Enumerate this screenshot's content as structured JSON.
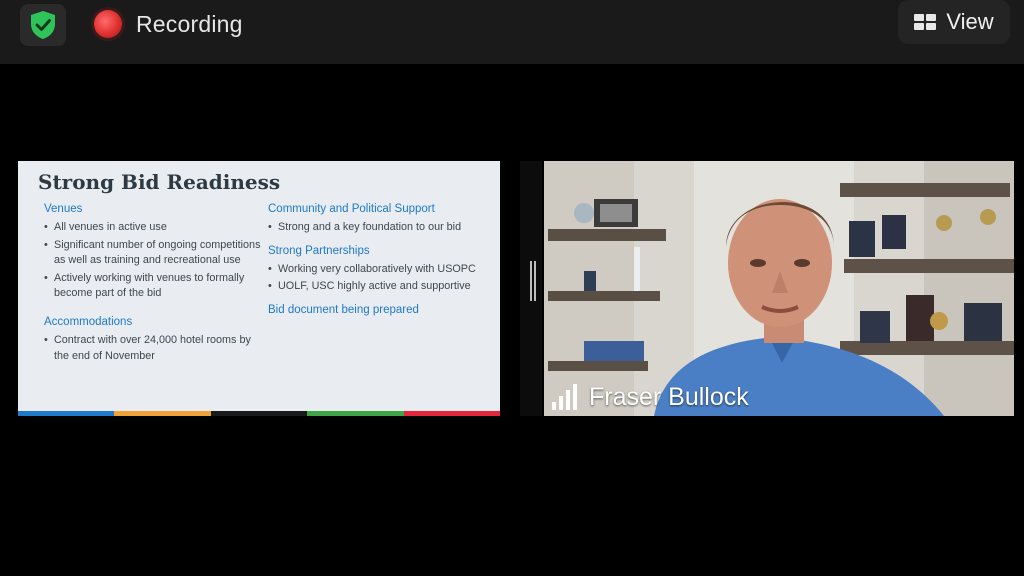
{
  "topbar": {
    "recording_label": "Recording",
    "view_label": "View",
    "icons": {
      "security": "shield-check-icon",
      "recording": "recording-dot-icon",
      "view": "grid-view-icon"
    }
  },
  "slide": {
    "title": "Strong Bid Readiness",
    "left_column": {
      "sections": [
        {
          "heading": "Venues",
          "bullets": [
            "All venues in active use",
            "Significant number of ongoing competitions as well as training and recreational use",
            "Actively working with venues to formally become part of the bid"
          ]
        },
        {
          "heading": "Accommodations",
          "bullets": [
            "Contract with over 24,000 hotel rooms by the end of November"
          ]
        }
      ]
    },
    "right_column": {
      "sections": [
        {
          "heading": "Community and Political Support",
          "bullets": [
            "Strong and a key foundation to our bid"
          ]
        },
        {
          "heading": "Strong Partnerships",
          "bullets": [
            "Working very collaboratively with USOPC",
            "UOLF, USC highly active and supportive"
          ]
        }
      ],
      "footer_heading": "Bid document being prepared"
    },
    "colors": {
      "heading": "#1e78c8",
      "stripe": [
        "#1f7ac9",
        "#f0a239",
        "#1a1a1a",
        "#3fa547",
        "#e3273d"
      ]
    }
  },
  "participant": {
    "name": "Fraser Bullock",
    "signal_icon": "signal-strength-icon"
  },
  "colors": {
    "shield": "#2ec45a",
    "recording": "#e0302f"
  }
}
